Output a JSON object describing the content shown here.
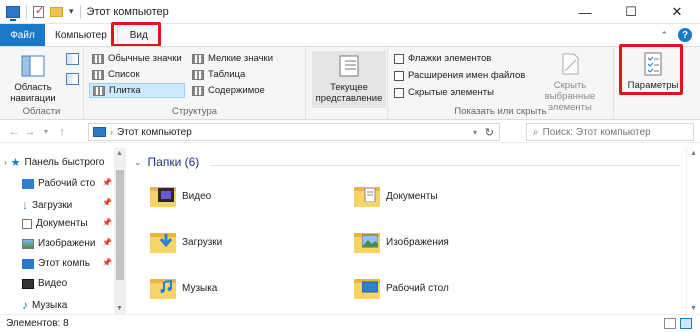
{
  "window": {
    "title": "Этот компьютер",
    "minimize": "—",
    "maximize": "☐",
    "close": "✕"
  },
  "tabs": [
    "Файл",
    "Компьютер",
    "Вид"
  ],
  "ribbon": {
    "panes": {
      "label_line1": "Область",
      "label_line2": "навигации",
      "group": "Области"
    },
    "structure": {
      "group": "Структура",
      "items": [
        "Обычные значки",
        "Мелкие значки",
        "Список",
        "Таблица",
        "Плитка",
        "Содержимое"
      ],
      "selected": "Плитка"
    },
    "current_view": {
      "label_line1": "Текущее",
      "label_line2": "представление"
    },
    "show_hide": {
      "group": "Показать или скрыть",
      "checkboxes": [
        "Флажки элементов",
        "Расширения имен файлов",
        "Скрытые элементы"
      ],
      "hide_selected_line1": "Скрыть выбранные",
      "hide_selected_line2": "элементы"
    },
    "options": {
      "label": "Параметры"
    }
  },
  "address": {
    "path": "Этот компьютер",
    "search_placeholder": "Поиск: Этот компьютер"
  },
  "navpane": {
    "items": [
      {
        "label": "Панель быстрого",
        "pinned": false
      },
      {
        "label": "Рабочий сто",
        "pinned": true
      },
      {
        "label": "Загрузки",
        "pinned": true
      },
      {
        "label": "Документы",
        "pinned": true
      },
      {
        "label": "Изображени",
        "pinned": true
      },
      {
        "label": "Этот компь",
        "pinned": true
      },
      {
        "label": "Видео",
        "pinned": false
      },
      {
        "label": "Музыка",
        "pinned": false
      }
    ]
  },
  "content": {
    "section_title": "Папки (6)",
    "folders": [
      "Видео",
      "Документы",
      "Загрузки",
      "Изображения",
      "Музыка",
      "Рабочий стол"
    ]
  },
  "status": {
    "text": "Элементов: 8"
  },
  "colors": {
    "accent": "#1979ca",
    "highlight": "#e0141e"
  }
}
